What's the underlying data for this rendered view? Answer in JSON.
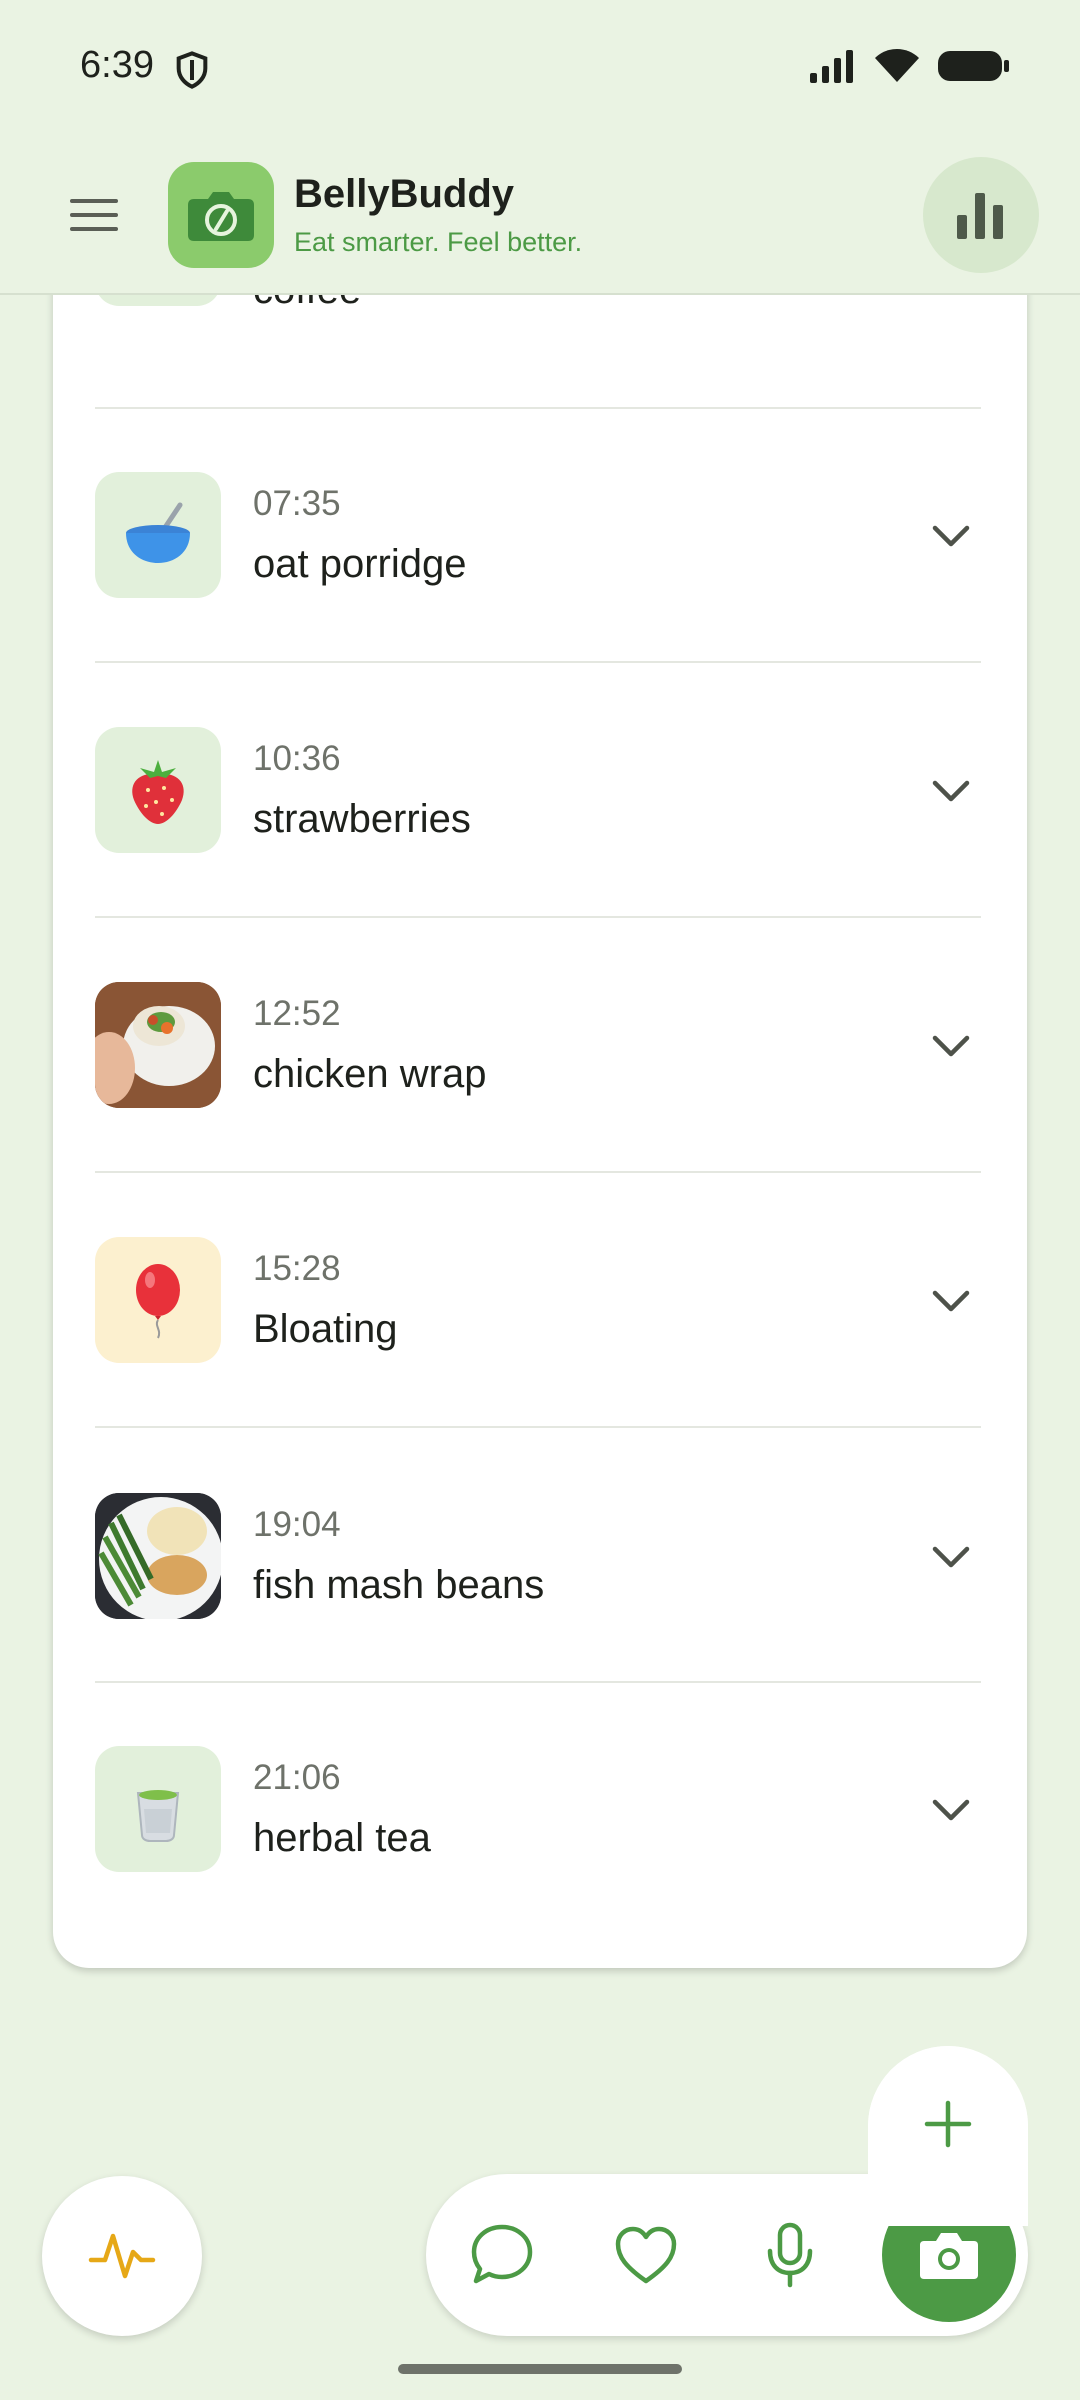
{
  "status_bar": {
    "time": "6:39",
    "icons": [
      "shield-icon",
      "signal-icon",
      "wifi-icon",
      "battery-icon"
    ]
  },
  "app_bar": {
    "title": "BellyBuddy",
    "subtitle": "Eat smarter. Feel better.",
    "menu_icon": "menu-icon",
    "logo_icon": "camera-fork-logo",
    "stats_icon": "bar-chart-icon"
  },
  "entries": [
    {
      "time": "",
      "name": "coffee",
      "kind": "food",
      "icon": "coffee-cup-emoji"
    },
    {
      "time": "07:35",
      "name": "oat porridge",
      "kind": "food",
      "icon": "bowl-with-spoon-emoji"
    },
    {
      "time": "10:36",
      "name": "strawberries",
      "kind": "food",
      "icon": "strawberry-emoji"
    },
    {
      "time": "12:52",
      "name": "chicken wrap",
      "kind": "food",
      "icon": "photo-chicken-wrap"
    },
    {
      "time": "15:28",
      "name": "Bloating",
      "kind": "symptom",
      "icon": "balloon-emoji"
    },
    {
      "time": "19:04",
      "name": "fish mash beans",
      "kind": "food",
      "icon": "photo-fish-mash-beans"
    },
    {
      "time": "21:06",
      "name": "herbal tea",
      "kind": "food",
      "icon": "tea-cup-emoji"
    }
  ],
  "bottom_bar": {
    "buttons": [
      "pulse-icon",
      "chat-icon",
      "heart-icon",
      "mic-icon",
      "camera-icon",
      "plus-icon"
    ]
  },
  "colors": {
    "background": "#EAF3E3",
    "primary_green": "#4C9A45",
    "logo_green": "#8BCB6C",
    "symptom_bg": "#FCF0CF",
    "food_bg": "#E2F0DB",
    "accent_yellow": "#E6A817"
  }
}
